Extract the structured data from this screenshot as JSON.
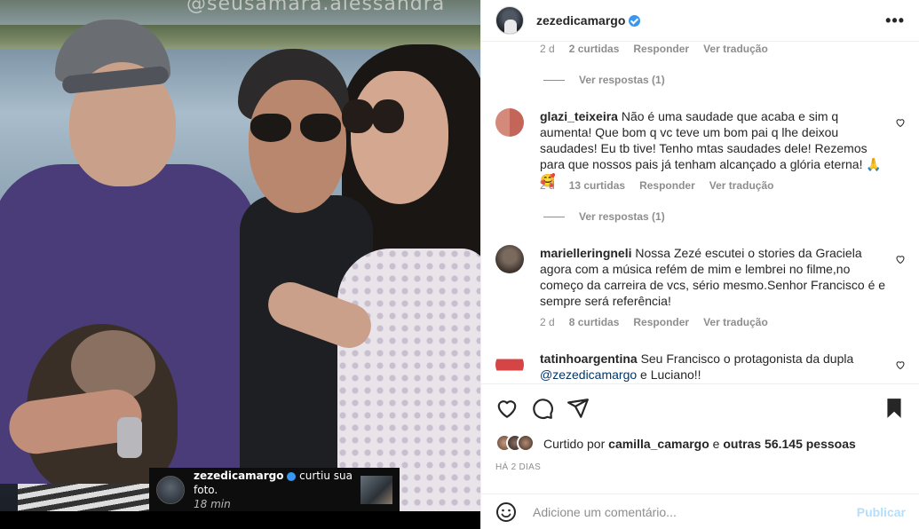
{
  "photo": {
    "watermark": "@seusamara.alessandra",
    "notification": {
      "username": "zezedicamargo",
      "action": "curtiu sua foto.",
      "time": "18 min"
    }
  },
  "header": {
    "username": "zezedicamargo",
    "more_label": "•••"
  },
  "comments": {
    "top_meta": {
      "time": "2 d",
      "likes": "2 curtidas",
      "reply": "Responder",
      "translate": "Ver tradução"
    },
    "items": [
      {
        "username": "glazi_teixeira",
        "text": "Não é uma saudade que acaba e sim q aumenta! Que bom q vc teve um bom pai q lhe deixou saudades! Eu tb tive! Tenho mtas saudades dele! Rezemos para que nossos pais já tenham alcançado a glória eterna! 🙏🥰",
        "time": "2 d",
        "likes": "13 curtidas",
        "reply": "Responder",
        "translate": "Ver tradução",
        "view_replies": "Ver respostas (1)"
      },
      {
        "username": "marielleringneli",
        "text": "Nossa Zezé escutei o stories da Graciela agora com a música refém de mim e lembrei no filme,no começo da carreira de vcs, sério mesmo.Senhor Francisco é e sempre será referência!",
        "time": "2 d",
        "likes": "8 curtidas",
        "reply": "Responder",
        "translate": "Ver tradução"
      },
      {
        "username": "tatinhoargentina",
        "text_before": "Seu Francisco o protagonista da dupla",
        "mention": "@zezedicamargo",
        "text_after": "e Luciano!!"
      }
    ],
    "first_view_replies": "Ver respostas (1)"
  },
  "likes": {
    "prefix": "Curtido por",
    "user": "camilla_camargo",
    "middle": "e",
    "others": "outras 56.145 pessoas"
  },
  "posted_ago": "HÁ 2 DIAS",
  "add_comment": {
    "placeholder": "Adicione um comentário...",
    "post_label": "Publicar"
  },
  "colors": {
    "verified": "#3897f0",
    "publish_disabled": "#b2dffc",
    "mention": "#00376b",
    "muted": "#8e8e8e"
  },
  "icons": [
    "heart-icon",
    "comment-icon",
    "share-icon",
    "bookmark-icon",
    "emoji-icon",
    "verified-badge-icon",
    "more-options-icon"
  ]
}
